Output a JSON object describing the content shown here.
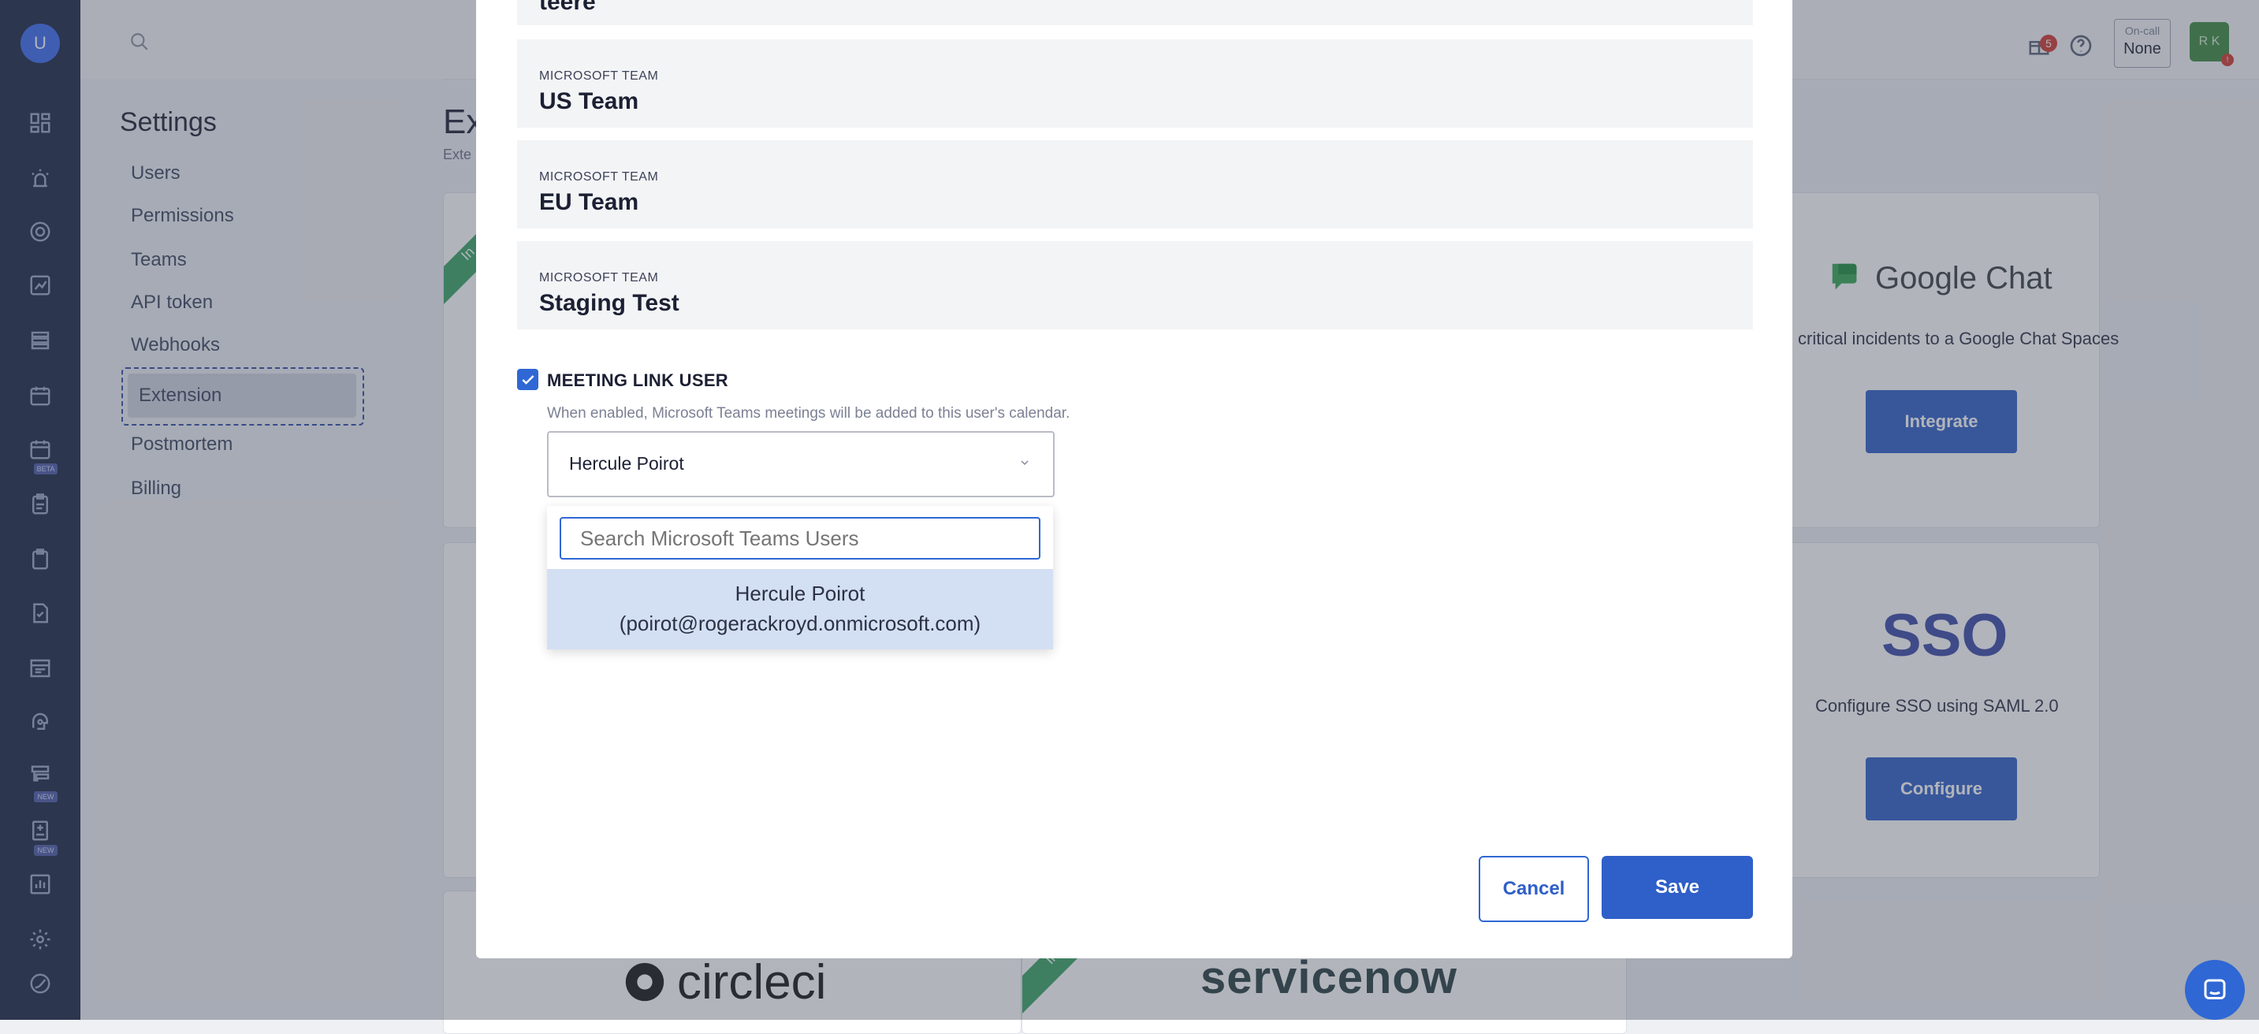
{
  "rail": {
    "avatar_initial": "U",
    "beta_badge": "BETA",
    "new_badge_1": "NEW",
    "new_badge_2": "NEW"
  },
  "topbar": {
    "notification_count": "5",
    "oncall_label": "On-call",
    "oncall_value": "None",
    "user_initials": "R K",
    "user_alert": "!"
  },
  "settings_nav": {
    "title": "Settings",
    "items": [
      {
        "label": "Users"
      },
      {
        "label": "Permissions"
      },
      {
        "label": "Teams"
      },
      {
        "label": "API token"
      },
      {
        "label": "Webhooks"
      },
      {
        "label": "Extension"
      },
      {
        "label": "Postmortem"
      },
      {
        "label": "Billing"
      }
    ]
  },
  "page": {
    "title_fragment": "Ex",
    "subtitle_fragment": "Exte"
  },
  "cards": {
    "integrated_ribbon": "In",
    "google_chat_name": "Google Chat",
    "google_chat_desc": "critical incidents to a Google Chat Spaces",
    "google_chat_button": "Integrate",
    "sso_logo": "SSO",
    "sso_desc": "Configure SSO using SAML 2.0",
    "sso_button": "Configure",
    "circleci_logo": "circleci",
    "servicenow_logo": "servicenow",
    "integrated_ribbon_2": "Int"
  },
  "modal": {
    "partial_team": "teere",
    "teams": [
      {
        "kind": "MICROSOFT TEAM",
        "name": "US Team"
      },
      {
        "kind": "MICROSOFT TEAM",
        "name": "EU Team"
      },
      {
        "kind": "MICROSOFT TEAM",
        "name": "Staging Test"
      }
    ],
    "meeting_link_label": "MEETING LINK USER",
    "meeting_link_help": "When enabled, Microsoft Teams meetings will be added to this user's calendar.",
    "selected_user": "Hercule Poirot",
    "search_placeholder": "Search Microsoft Teams Users",
    "option_name": "Hercule Poirot",
    "option_email": "(poirot@rogerackroyd.onmicrosoft.com)",
    "cancel_label": "Cancel",
    "save_label": "Save"
  }
}
